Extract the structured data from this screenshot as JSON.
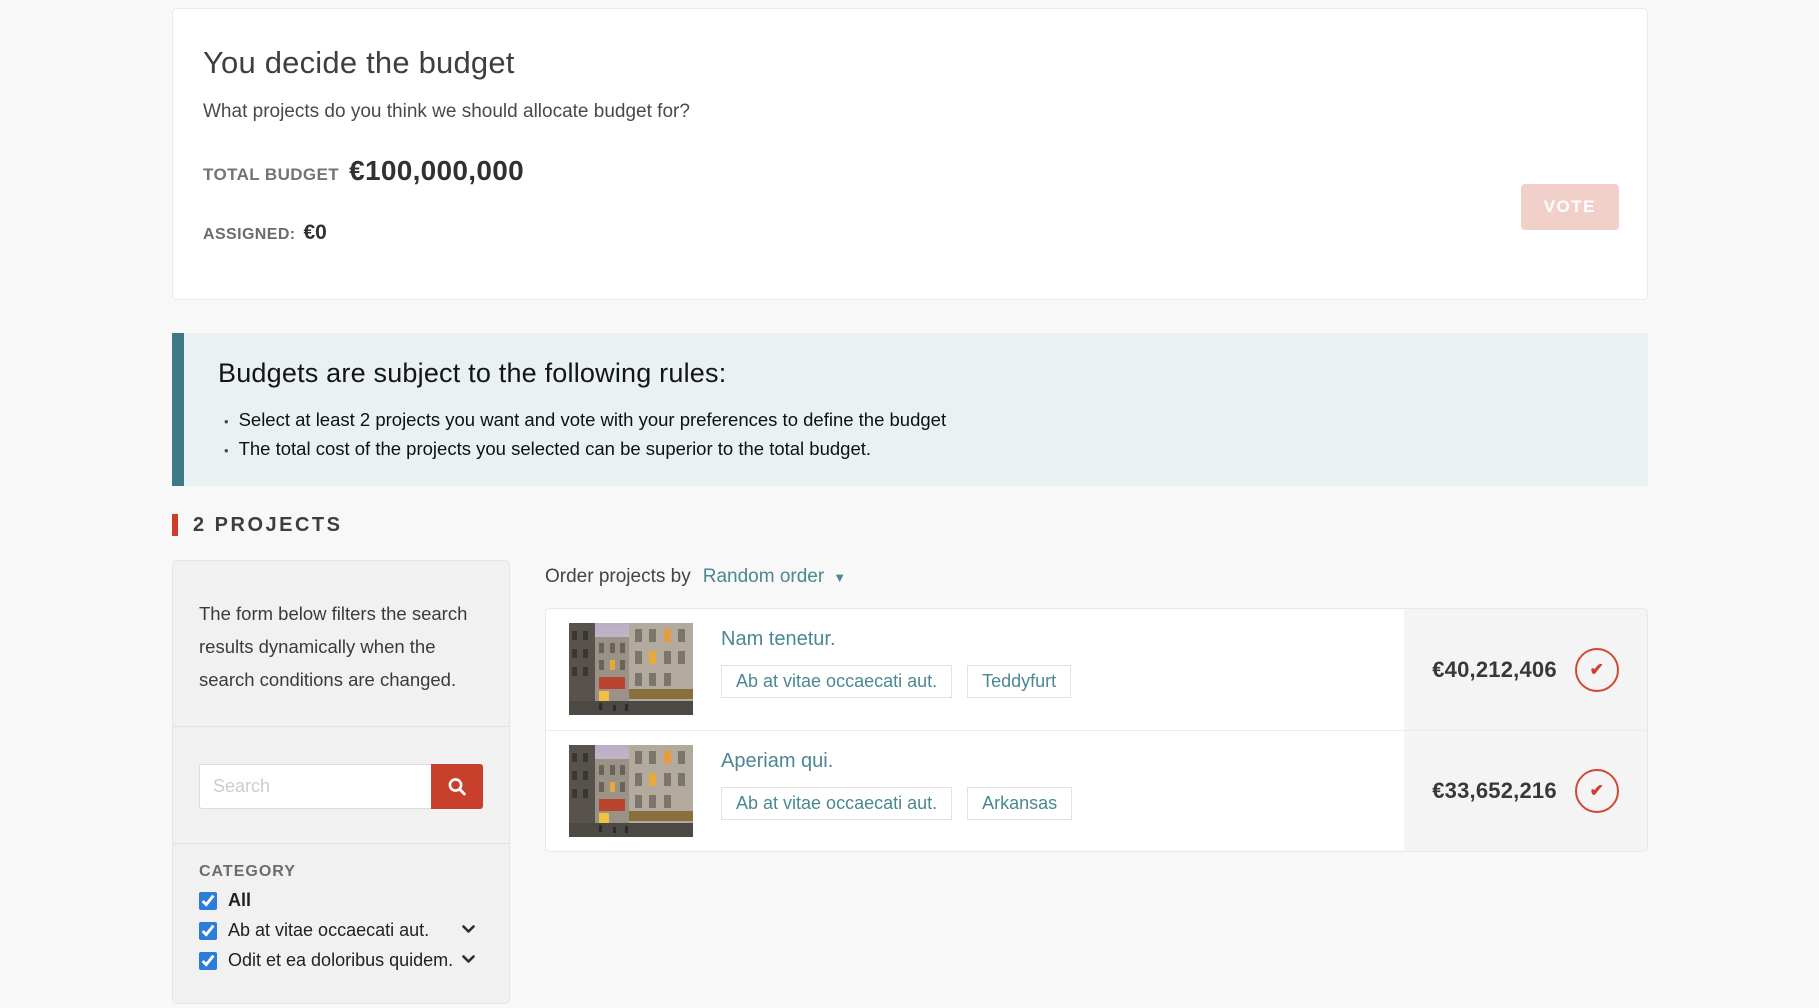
{
  "budget_summary": {
    "title": "You decide the budget",
    "subtitle": "What projects do you think we should allocate budget for?",
    "total_budget_label": "TOTAL BUDGET",
    "total_budget_value": "€100,000,000",
    "vote_button_label": "VOTE",
    "vote_button_enabled": false,
    "assigned_label": "ASSIGNED:",
    "assigned_value": "€0"
  },
  "rules": {
    "heading": "Budgets are subject to the following rules:",
    "bullet_glyph": "•",
    "items": [
      "Select at least 2 projects you want and vote with your preferences to define the budget",
      "The total cost of the projects you selected can be superior to the total budget."
    ]
  },
  "projects_section": {
    "heading": "2 PROJECTS",
    "order_label": "Order projects by",
    "order_value": "Random order",
    "order_caret": "▼"
  },
  "filters": {
    "description": "The form below filters the search results dynamically when the search conditions are changed.",
    "search_placeholder": "Search",
    "search_value": "",
    "category_label": "CATEGORY",
    "options": [
      {
        "label": "All",
        "checked": true,
        "expandable": false
      },
      {
        "label": "Ab at vitae occaecati aut.",
        "checked": true,
        "expandable": true
      },
      {
        "label": "Odit et ea doloribus quidem.",
        "checked": true,
        "expandable": true
      }
    ]
  },
  "projects": [
    {
      "title": "Nam tenetur.",
      "tags": [
        "Ab at vitae occaecati aut.",
        "Teddyfurt"
      ],
      "price": "€40,212,406",
      "selected": true
    },
    {
      "title": "Aperiam qui.",
      "tags": [
        "Ab at vitae occaecati aut.",
        "Arkansas"
      ],
      "price": "€33,652,216",
      "selected": true
    }
  ],
  "icons": {
    "search-icon": "magnifying glass",
    "chevron-down-icon": "chevron down",
    "dropdown-caret-icon": "filled triangle down",
    "check-icon": "✔"
  },
  "colors": {
    "accent_red": "#c8402c",
    "section_bar_red": "#cb3c29",
    "teal_link": "#4a8893",
    "rules_border_teal": "#3d7a85",
    "rules_background": "#e9f1f2",
    "checkbox_blue": "#2b7dd8",
    "vote_disabled_bg": "#f2d0ca",
    "select_circle_red": "#cf4a33",
    "page_background": "#f8f8f8"
  }
}
